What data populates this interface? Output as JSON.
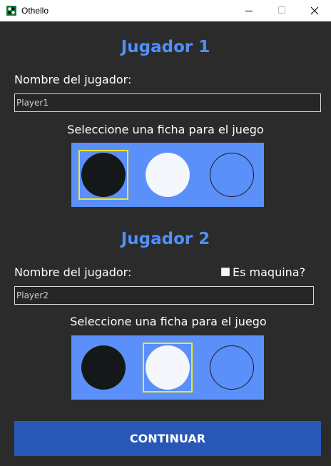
{
  "window": {
    "title": "Othello"
  },
  "player1": {
    "heading": "Jugador 1",
    "name_label": "Nombre del jugador:",
    "name_value": "Player1",
    "select_label": "Seleccione una ficha para el juego",
    "pieces": [
      {
        "name": "black",
        "color": "#141818",
        "selected": true
      },
      {
        "name": "white",
        "color": "#f3f6fb",
        "selected": false
      },
      {
        "name": "blue",
        "color": "#5b8ff9",
        "selected": false
      }
    ]
  },
  "player2": {
    "heading": "Jugador 2",
    "name_label": "Nombre del jugador:",
    "machine_checkbox_label": "Es maquina?",
    "machine_checked": false,
    "name_value": "Player2",
    "select_label": "Seleccione una ficha para el juego",
    "pieces": [
      {
        "name": "black",
        "color": "#141818",
        "selected": false
      },
      {
        "name": "white",
        "color": "#f3f6fb",
        "selected": true
      },
      {
        "name": "blue",
        "color": "#5b8ff9",
        "selected": false
      }
    ]
  },
  "actions": {
    "continue_label": "CONTINUAR"
  },
  "colors": {
    "background": "#2b2b2b",
    "accent": "#4f8ff7",
    "panel": "#5b8ff9",
    "selection": "#f0e82a",
    "button": "#2957b6"
  }
}
